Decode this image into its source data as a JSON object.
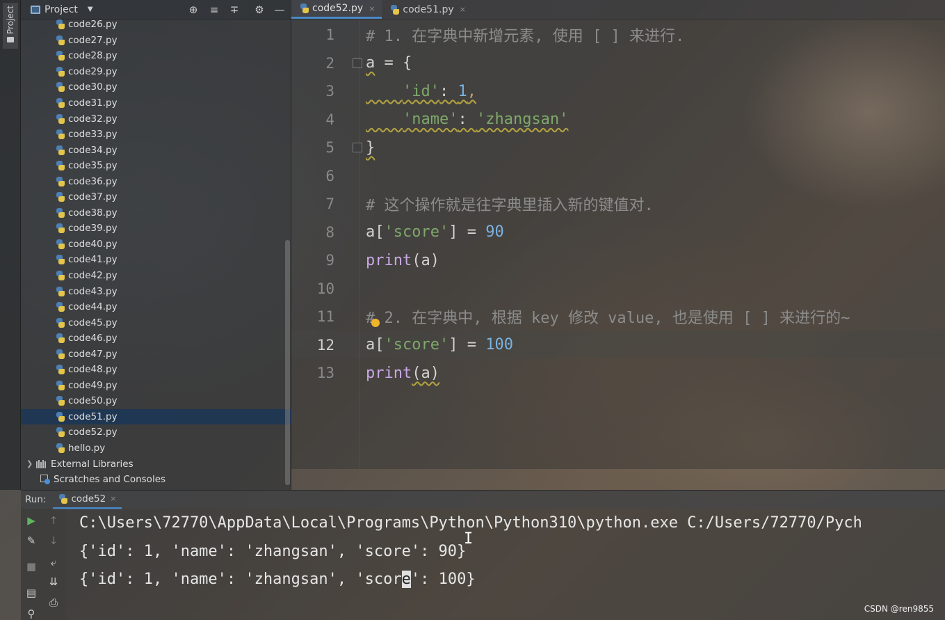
{
  "left_strip": {
    "label": "Project"
  },
  "project_panel": {
    "title": "Project",
    "files": [
      "code26.py",
      "code27.py",
      "code28.py",
      "code29.py",
      "code30.py",
      "code31.py",
      "code32.py",
      "code33.py",
      "code34.py",
      "code35.py",
      "code36.py",
      "code37.py",
      "code38.py",
      "code39.py",
      "code40.py",
      "code41.py",
      "code42.py",
      "code43.py",
      "code44.py",
      "code45.py",
      "code46.py",
      "code47.py",
      "code48.py",
      "code49.py",
      "code50.py",
      "code51.py",
      "code52.py",
      "hello.py"
    ],
    "selected_file": "code51.py",
    "external_libraries": "External Libraries",
    "scratches": "Scratches and Consoles"
  },
  "tabs": [
    {
      "label": "code52.py",
      "active": true
    },
    {
      "label": "code51.py",
      "active": false
    }
  ],
  "editor": {
    "current_line": 12,
    "lines": [
      {
        "n": "1",
        "code": "# 1. 在字典中新增元素, 使用 [ ] 来进行."
      },
      {
        "n": "2",
        "code": "a = {"
      },
      {
        "n": "3",
        "code": "    'id': 1,"
      },
      {
        "n": "4",
        "code": "    'name': 'zhangsan'"
      },
      {
        "n": "5",
        "code": "}"
      },
      {
        "n": "6",
        "code": ""
      },
      {
        "n": "7",
        "code": "# 这个操作就是往字典里插入新的键值对."
      },
      {
        "n": "8",
        "code": "a['score'] = 90"
      },
      {
        "n": "9",
        "code": "print(a)"
      },
      {
        "n": "10",
        "code": ""
      },
      {
        "n": "11",
        "code": "# 2. 在字典中, 根据 key 修改 value, 也是使用 [ ] 来进行的~"
      },
      {
        "n": "12",
        "code": "a['score'] = 100"
      },
      {
        "n": "13",
        "code": "print(a)"
      }
    ],
    "tokens": {
      "l1": "# 1. 在字典中新增元素, 使用 [ ] 来进行.",
      "l2_var": "a",
      "l2_rest": " = {",
      "l3_indent": "    ",
      "l3_key": "'id'",
      "l3_colon": ": ",
      "l3_val": "1",
      "l3_comma": ",",
      "l4_indent": "    ",
      "l4_key": "'name'",
      "l4_colon": ": ",
      "l4_val": "'zhangsan'",
      "l5": "}",
      "l7": "# 这个操作就是往字典里插入新的键值对.",
      "l8_a": "a[",
      "l8_key": "'score'",
      "l8_mid": "] = ",
      "l8_val": "90",
      "l9_fn": "print",
      "l9_rest": "(a)",
      "l11": "# 2. 在字典中, 根据 key 修改 value, 也是使用 [ ] 来进行的~",
      "l12_a": "a[",
      "l12_key": "'score'",
      "l12_mid": "] = ",
      "l12_val": "100",
      "l13_fn": "print",
      "l13_rest": "(a)"
    }
  },
  "run_panel": {
    "label": "Run:",
    "tab": "code52",
    "output": [
      "C:\\Users\\72770\\AppData\\Local\\Programs\\Python\\Python310\\python.exe C:/Users/72770/Pych",
      "{'id': 1, 'name': 'zhangsan', 'score': 90}"
    ],
    "output_line3_before": "{'id': 1, 'name': 'zhangsan', 'scor",
    "output_line3_caret": "e",
    "output_line3_after": "': 100}"
  },
  "watermark": "CSDN @ren9855",
  "colors": {
    "accent_tab_underline": "#4a88c7",
    "string": "#7fa86a",
    "number": "#7ab2e0",
    "function": "#c8a8e6",
    "comment": "#8c8c8c",
    "selection": "#1e3755"
  }
}
